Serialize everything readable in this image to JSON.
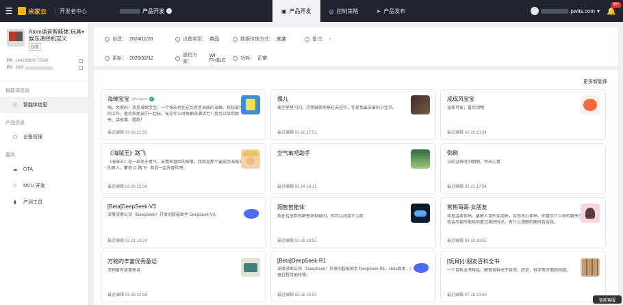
{
  "topbar": {
    "logo_text": "米家云",
    "portal": "开发者中心",
    "crumb": "产品开发",
    "tabs": [
      {
        "label": "产品开发",
        "icon": "box-icon"
      },
      {
        "label": "控制策略",
        "icon": "bulb-icon"
      },
      {
        "label": "产品发布",
        "icon": "send-icon"
      }
    ],
    "user": "pwits.com",
    "badge": "99+",
    "colors": {
      "bg": "#1f2430",
      "badge": "#f5222d"
    }
  },
  "sidebar": {
    "product_name": "Atom语音智能体 玩具娱乐演绎机定义",
    "tag": "玩具",
    "pk_label": "PK:",
    "pk_value": "c84293930 72546",
    "ps_label": "PS:",
    "ps_value": "889f",
    "sections": [
      {
        "title": "智能体信息",
        "items": [
          {
            "label": "智能体信息",
            "icon": "info-icon",
            "active": true
          }
        ]
      },
      {
        "title": "产品信息",
        "items": [
          {
            "label": "设备管理",
            "icon": "device-icon",
            "active": false
          }
        ]
      },
      {
        "title": "服务",
        "items": [
          {
            "label": "OTA",
            "icon": "cloud-icon",
            "active": false
          },
          {
            "label": "MCU 开发",
            "icon": "code-icon",
            "active": false
          },
          {
            "label": "产测工具",
            "icon": "tool-icon",
            "active": false
          }
        ]
      }
    ]
  },
  "info": {
    "row1": [
      {
        "label": "创建：",
        "value": "2024/11/26"
      },
      {
        "label": "设备类型：",
        "value": "单品"
      },
      {
        "label": "数据传输方式：",
        "value": "安装"
      },
      {
        "label": "备注：",
        "value": "-"
      }
    ],
    "row2": [
      {
        "label": "更新：",
        "value": "2026/02/12"
      },
      {
        "label": "通信方案：",
        "value": "WI-FI+BLE"
      },
      {
        "label": "功耗：",
        "value": "正常"
      }
    ]
  },
  "panel": {
    "link": "更多智能体"
  },
  "agents": [
    {
      "title": "海绵宝宝",
      "sub": "@hi.agent",
      "verified": true,
      "desc": "嗨，大家好！我是海绵宝宝，一个快乐地住在比奇堡海底的海绵。我热爱我的工作，喜欢和朋友们一起玩，无论什么时候都充满活力！我可以陪你聊天、讲故事、唱歌！",
      "time": "最近编辑 02-16 21:55",
      "img": "sponge"
    },
    {
      "title": "娱儿",
      "sub": "",
      "verified": false,
      "desc": "夜空星星闪闪，月亮微笑地悬在天空中，你是我最亲爱的小宝贝。",
      "time": "最近编辑 02-20 17:51",
      "img": "dark"
    },
    {
      "title": "成成风宝宝",
      "sub": "",
      "verified": false,
      "desc": "温柔可爱，喜欢动物",
      "time": "最近编辑 02-20 15:34",
      "img": "bear"
    },
    {
      "title": "《海贼王》路飞",
      "sub": "",
      "verified": false,
      "desc": "《海贼王》是一部关于勇气、友情和冒险的故事。我就是那个要成为海贼王的男人，蒙奇·D·路飞！和我一起去冒险吧。",
      "time": "最近编辑 02-26 15:54",
      "img": "luffy"
    },
    {
      "title": "空气氧吧助手",
      "sub": "",
      "verified": false,
      "desc": "",
      "time": "最近编辑 02-24 10:13",
      "img": "forest"
    },
    {
      "title": "倒刷",
      "sub": "",
      "verified": false,
      "desc": "以前没有时间倒刷，今天心事",
      "time": "最近编辑 02-21 17:54",
      "img": "plain"
    },
    {
      "title": "[Beta]DeepSeek-V3",
      "sub": "",
      "verified": false,
      "desc": "深度求索公司（DeepSeek）开发的智能助手 DeepSeek-V3。",
      "time": "最近编辑 02-21 13:24",
      "img": "whale"
    },
    {
      "title": "网智智能体",
      "sub": "",
      "verified": false,
      "desc": "我在这里帮你解答各种疑问，你可以问我什么呢",
      "time": "最近编辑 03-19 18:52",
      "img": "cloud"
    },
    {
      "title": "熊熊哥哥·女朋友",
      "sub": "",
      "verified": false,
      "desc": "我是温柔体贴、善解人意的女朋友，对你关心体贴。你喜欢什么样的聊天？我会尽我所能陪你度过美好时光，有什么想聊的随时告诉我。",
      "time": "最近编辑 03-19 18:52",
      "img": "girl"
    },
    {
      "title": "万物的丰富优秀童话",
      "sub": "",
      "verified": false,
      "desc": "万物皆有故事来讲",
      "time": "最近编辑 03-16 22:55",
      "img": "radio"
    },
    {
      "title": "[Beta]DeepSeek-R1",
      "sub": "",
      "verified": false,
      "desc": "深度求索公司（DeepSeek）开发的智能助手 DeepSeek-R1，Beta版本，推理过程可能较慢。",
      "time": "最近编辑 02-18 20:51",
      "img": "whale"
    },
    {
      "title": "[玩具]小朋友百科全书",
      "sub": "",
      "verified": false,
      "desc": "一个百科全书角色，解答各种关于自然、历史、科学等方面的问题。",
      "time": "最近编辑 07-18 20:55",
      "img": "faces"
    }
  ],
  "float_label": "智能客服"
}
